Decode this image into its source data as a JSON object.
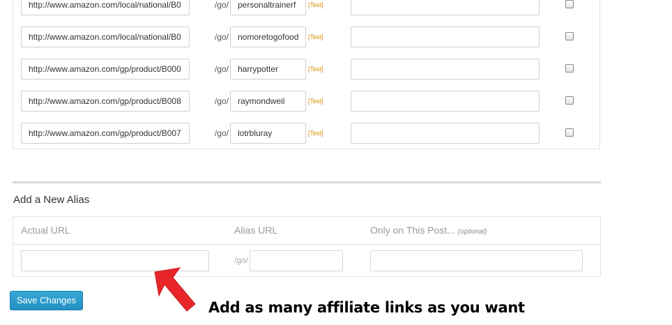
{
  "aliases": {
    "go_prefix": "/go/",
    "test_label": "[Test]",
    "rows": [
      {
        "url": "http://www.amazon.com/local/national/B0",
        "alias": "personaltrainerf",
        "post": "",
        "checked": false
      },
      {
        "url": "http://www.amazon.com/local/national/B0",
        "alias": "nomoretogofood",
        "post": "",
        "checked": false
      },
      {
        "url": "http://www.amazon.com/gp/product/B000",
        "alias": "harrypotter",
        "post": "",
        "checked": false
      },
      {
        "url": "http://www.amazon.com/gp/product/B008",
        "alias": "raymondweil",
        "post": "",
        "checked": false
      },
      {
        "url": "http://www.amazon.com/gp/product/B007",
        "alias": "lotrbluray",
        "post": "",
        "checked": false
      }
    ]
  },
  "new_alias": {
    "title": "Add a New Alias",
    "col_actual": "Actual URL",
    "col_alias": "Alias URL",
    "col_post": "Only on This Post...",
    "col_post_optional": "(optional)",
    "go_prefix": "/go/",
    "actual_value": "",
    "alias_value": "",
    "post_value": ""
  },
  "save_label": "Save Changes",
  "annotation": "Add as many affiliate links as you want",
  "colors": {
    "button": "#2a9bd0",
    "test_link": "#d98e00",
    "arrow": "#e8262a"
  }
}
